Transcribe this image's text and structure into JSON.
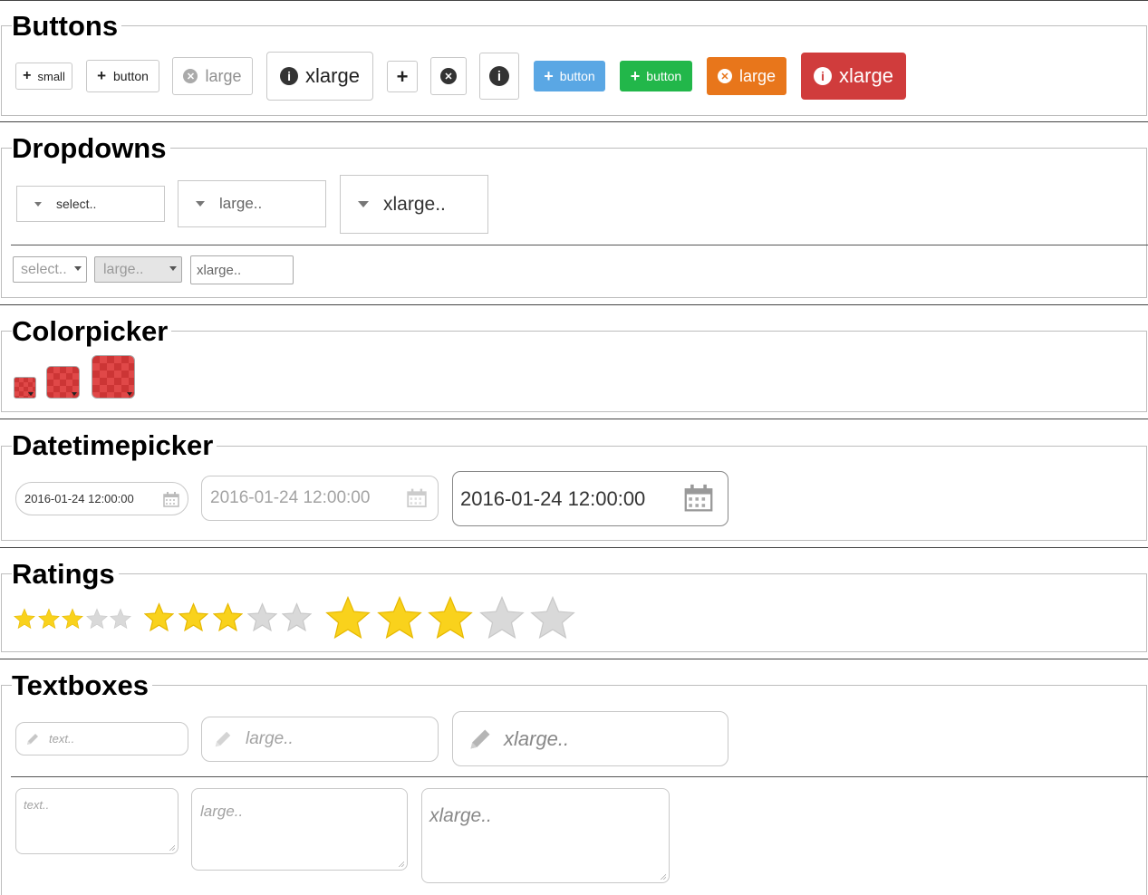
{
  "sections": {
    "buttons": "Buttons",
    "dropdowns": "Dropdowns",
    "colorpicker": "Colorpicker",
    "datetimepicker": "Datetimepicker",
    "ratings": "Ratings",
    "textboxes": "Textboxes"
  },
  "buttons": {
    "small": "small",
    "button": "button",
    "large": "large",
    "xlarge": "xlarge",
    "primary_button": "button",
    "success_button": "button",
    "warning_large": "large",
    "danger_xlarge": "xlarge"
  },
  "dropdowns": {
    "select": "select..",
    "large": "large..",
    "xlarge": "xlarge.."
  },
  "native_selects": {
    "select": "select..",
    "large": "large..",
    "xlarge": "xlarge.."
  },
  "datetimepicker": {
    "small": "2016-01-24 12:00:00",
    "large": "2016-01-24 12:00:00",
    "xlarge": "2016-01-24 12:00:00"
  },
  "ratings": {
    "small": {
      "value": 3,
      "max": 5
    },
    "large": {
      "value": 3,
      "max": 5
    },
    "xlarge": {
      "value": 3,
      "max": 5
    }
  },
  "textboxes": {
    "text_placeholder": "text..",
    "large_placeholder": "large..",
    "xlarge_placeholder": "xlarge.."
  },
  "textareas": {
    "text_placeholder": "text..",
    "large_placeholder": "large..",
    "xlarge_placeholder": "xlarge.."
  },
  "colors": {
    "primary": "#5aa7e4",
    "success": "#22b74a",
    "warning": "#e8761b",
    "danger": "#d03c3c",
    "star_filled": "#f9d21c",
    "star_empty": "#d9d9d9",
    "colorpicker": "#d63c3c"
  }
}
